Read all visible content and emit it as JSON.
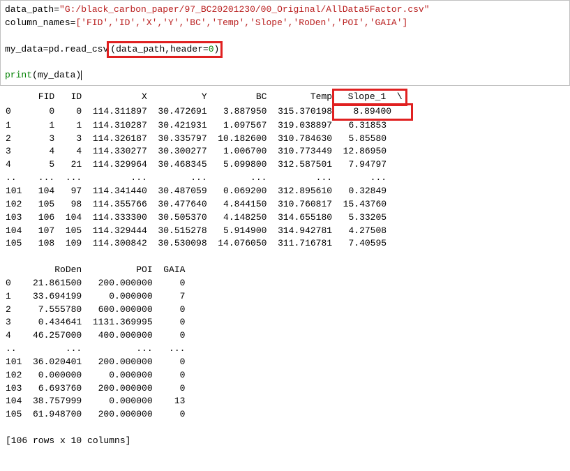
{
  "code": {
    "data_path_var": "data_path",
    "data_path_val": "\"G:/black_carbon_paper/97_BC20201230/00_Original/AllData5Factor.csv\"",
    "column_names_var": "column_names",
    "column_names_val": "['FID','ID','X','Y','BC','Temp','Slope','RoDen','POI','GAIA']",
    "read_lhs": "my_data",
    "read_mod": "pd",
    "read_fn": "read_csv",
    "read_args_boxed": "(data_path,header=0)",
    "header_num": "0",
    "print_name": "print",
    "print_arg": "my_data"
  },
  "output": {
    "header1": "      FID   ID           X          Y         BC        Temp",
    "header1_boxed": "  Slope_1  \\",
    "rows1": [
      "0       0    0  114.311897  30.472691   3.887950  315.370198",
      "1       1    1  114.310287  30.421931   1.097567  319.038897   6.31853   ",
      "2       3    3  114.326187  30.335797  10.182600  310.784630   5.85580   ",
      "3       4    4  114.330277  30.300277   1.006700  310.773449  12.86950   ",
      "4       5   21  114.329964  30.468345   5.099800  312.587501   7.94797   "
    ],
    "row0_boxed_tail": "   8.89400   ",
    "ellipsis1": "..    ...  ...         ...        ...        ...         ...       ...   ",
    "rows1b": [
      "101   104   97  114.341440  30.487059   0.069200  312.895610   0.32849   ",
      "102   105   98  114.355766  30.477640   4.844150  310.760817  15.43760   ",
      "103   106  104  114.333300  30.505370   4.148250  314.655180   5.33205   ",
      "104   107  105  114.329444  30.515278   5.914900  314.942781   4.27508   ",
      "105   108  109  114.300842  30.530098  14.076050  311.716781   7.40595   "
    ],
    "header2": "         RoDen          POI  GAIA  ",
    "rows2": [
      "0    21.861500   200.000000     0  ",
      "1    33.694199     0.000000     7  ",
      "2     7.555780   600.000000     0  ",
      "3     0.434641  1131.369995     0  ",
      "4    46.257000   400.000000     0  "
    ],
    "ellipsis2": "..         ...          ...   ...  ",
    "rows2b": [
      "101  36.020401   200.000000     0  ",
      "102   0.000000     0.000000     0  ",
      "103   6.693760   200.000000     0  ",
      "104  38.757999     0.000000    13  ",
      "105  61.948700   200.000000     0  "
    ],
    "footer": "[106 rows x 10 columns]"
  }
}
